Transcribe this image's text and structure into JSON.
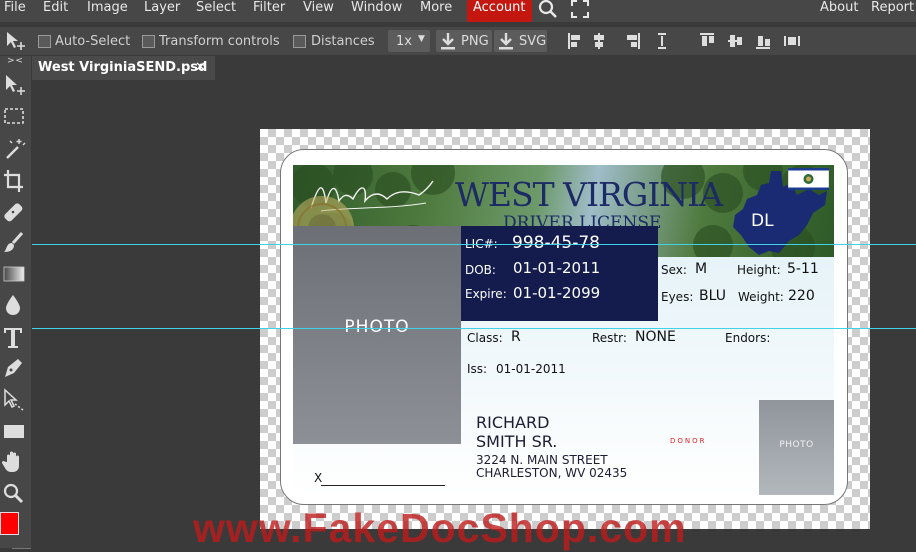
{
  "menu": {
    "items": [
      "File",
      "Edit",
      "Image",
      "Layer",
      "Select",
      "Filter",
      "View",
      "Window",
      "More"
    ],
    "account": "Account",
    "about": "About",
    "report": "Report"
  },
  "options": {
    "auto_select": "Auto-Select",
    "transform_controls": "Transform controls",
    "distances": "Distances",
    "zoom": "1x",
    "png": "PNG",
    "svg": "SVG"
  },
  "tab": {
    "title": "West VirginiaSEND.psd",
    "close": "✕"
  },
  "toolbar": {
    "collapse": "> <"
  },
  "colors": {
    "foreground": "#ff0000",
    "background": "#000000",
    "accent": "#c4170f",
    "guide": "#3fd3e8"
  },
  "license": {
    "state": "WEST VIRGINIA",
    "type": "DRIVER LICENSE",
    "class_badge": "DL",
    "signature": "Harold Kiddley",
    "photo_label": "PHOTO",
    "lic_label": "LIC#:",
    "lic": "998-45-78",
    "dob_label": "DOB:",
    "dob": "01-01-2011",
    "expire_label": "Expire:",
    "expire": "01-01-2099",
    "sex_label": "Sex:",
    "sex": "M",
    "height_label": "Height:",
    "height": "5-11",
    "eyes_label": "Eyes:",
    "eyes": "BLU",
    "weight_label": "Weight:",
    "weight": "220",
    "class_label": "Class:",
    "class": "R",
    "restr_label": "Restr:",
    "restr": "NONE",
    "endors_label": "Endors:",
    "iss_label": "Iss:",
    "iss": "01-01-2011",
    "name1": "RICHARD",
    "name2": "SMITH SR.",
    "addr1": "3224 N. MAIN STREET",
    "addr2": "CHARLESTON, WV 02435",
    "donor": "DONOR",
    "photo2_label": "PHOTO",
    "sig_x": "X"
  },
  "watermark": "www.FakeDocShop.com"
}
